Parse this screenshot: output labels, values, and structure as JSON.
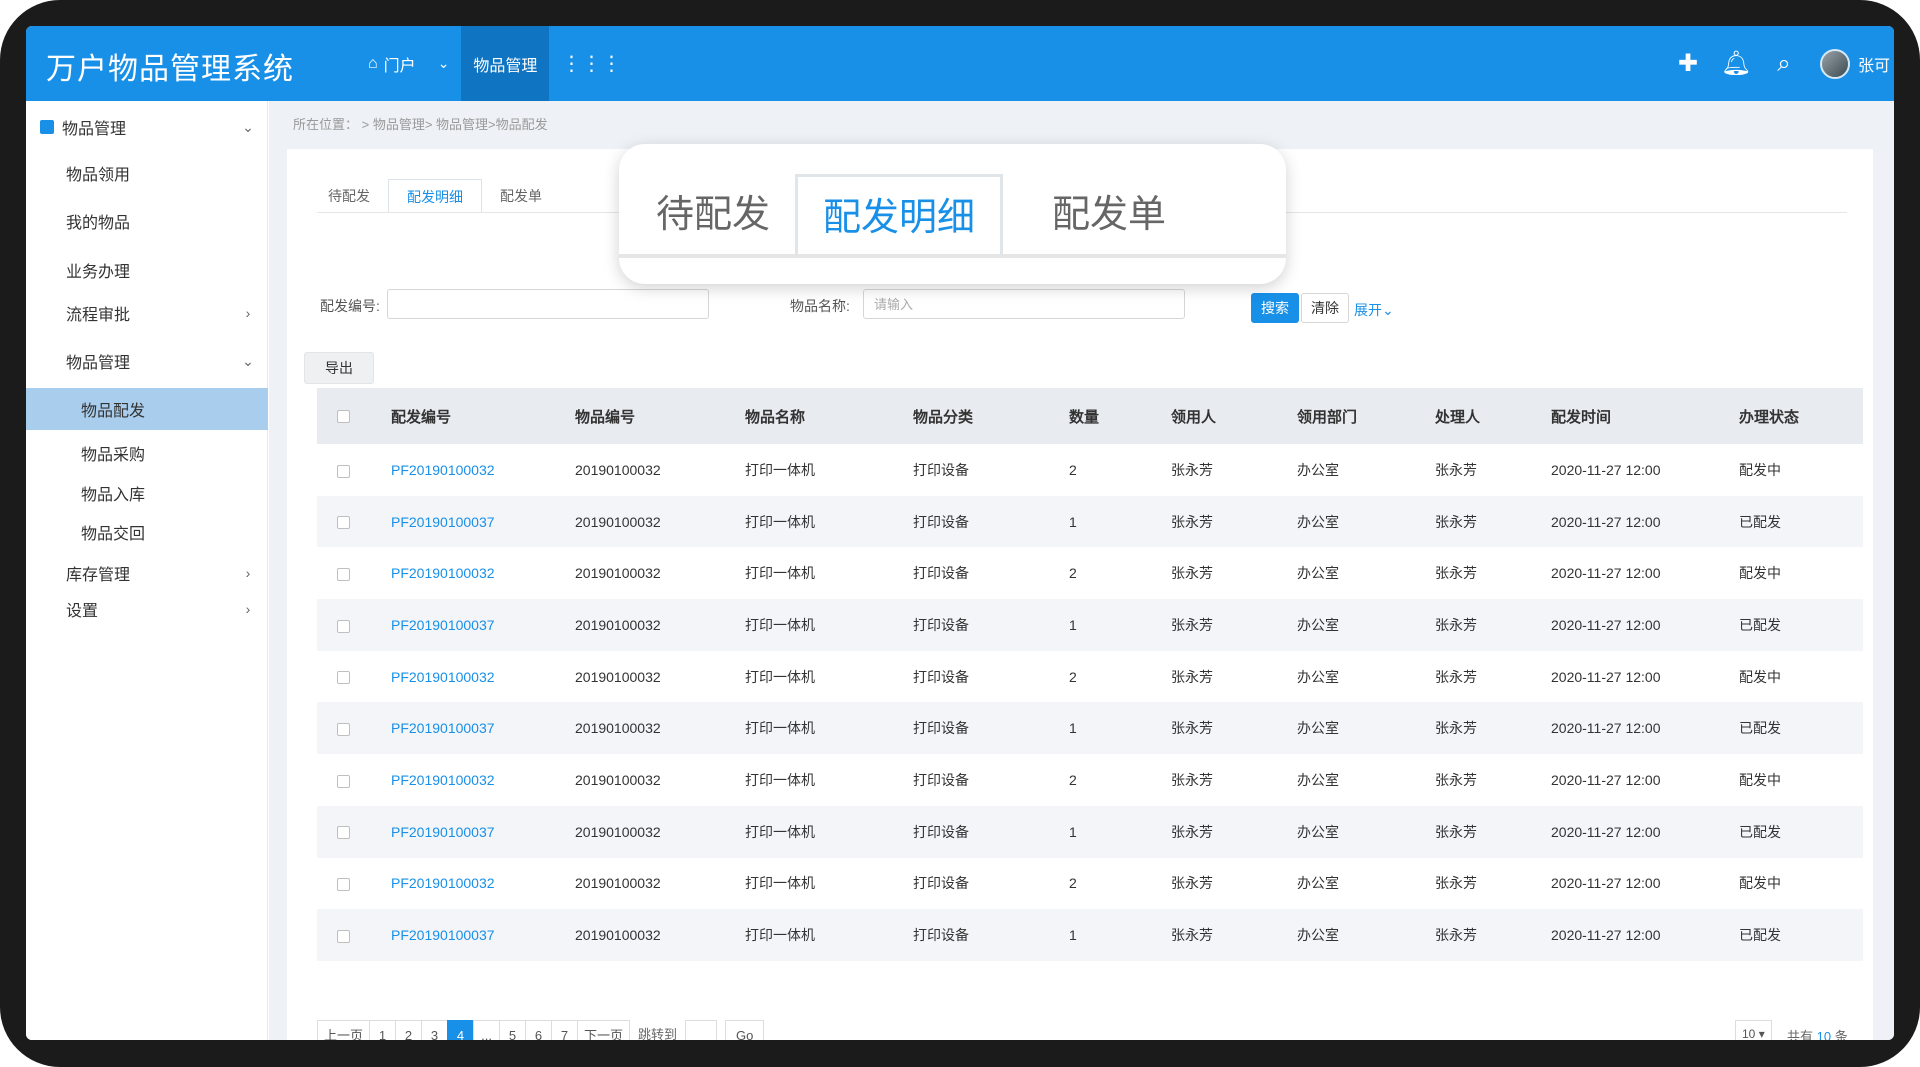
{
  "header": {
    "app_title": "万户物品管理系统",
    "nav": [
      {
        "icon": "home-icon",
        "label": "门户",
        "has_chevron": true
      },
      {
        "label": "物品管理",
        "active": true
      },
      {
        "icon": "grid-icon",
        "label": ""
      }
    ],
    "right_icons": [
      "plus-icon",
      "bell-icon",
      "search-icon"
    ],
    "username": "张可"
  },
  "sidebar": {
    "top": {
      "label": "物品管理"
    },
    "items": [
      {
        "label": "物品领用"
      },
      {
        "label": "我的物品"
      },
      {
        "label": "业务办理"
      },
      {
        "label": "流程审批"
      },
      {
        "label": "物品管理"
      },
      {
        "label": "物品配发",
        "active": true
      },
      {
        "label": "物品采购"
      },
      {
        "label": "物品入库"
      },
      {
        "label": "物品交回"
      },
      {
        "label": "库存管理"
      },
      {
        "label": "设置"
      }
    ]
  },
  "breadcrumb": "所在位置： > 物品管理> 物品管理>物品配发",
  "tabs": [
    "待配发",
    "配发明细",
    "配发单"
  ],
  "active_tab": "配发明细",
  "filters": {
    "code_label": "配发编号:",
    "code_value": "",
    "name_label": "物品名称:",
    "name_placeholder": "请输入",
    "search_label": "搜索",
    "clear_label": "清除",
    "expand_label": "展开"
  },
  "export_label": "导出",
  "table": {
    "columns": [
      "配发编号",
      "物品编号",
      "物品名称",
      "物品分类",
      "数量",
      "领用人",
      "领用部门",
      "处理人",
      "配发时间",
      "办理状态"
    ],
    "rows": [
      [
        "PF20190100032",
        "20190100032",
        "打印一体机",
        "打印设备",
        "2",
        "张永芳",
        "办公室",
        "张永芳",
        "2020-11-27 12:00",
        "配发中"
      ],
      [
        "PF20190100037",
        "20190100032",
        "打印一体机",
        "打印设备",
        "1",
        "张永芳",
        "办公室",
        "张永芳",
        "2020-11-27 12:00",
        "已配发"
      ],
      [
        "PF20190100032",
        "20190100032",
        "打印一体机",
        "打印设备",
        "2",
        "张永芳",
        "办公室",
        "张永芳",
        "2020-11-27 12:00",
        "配发中"
      ],
      [
        "PF20190100037",
        "20190100032",
        "打印一体机",
        "打印设备",
        "1",
        "张永芳",
        "办公室",
        "张永芳",
        "2020-11-27 12:00",
        "已配发"
      ],
      [
        "PF20190100032",
        "20190100032",
        "打印一体机",
        "打印设备",
        "2",
        "张永芳",
        "办公室",
        "张永芳",
        "2020-11-27 12:00",
        "配发中"
      ],
      [
        "PF20190100037",
        "20190100032",
        "打印一体机",
        "打印设备",
        "1",
        "张永芳",
        "办公室",
        "张永芳",
        "2020-11-27 12:00",
        "已配发"
      ],
      [
        "PF20190100032",
        "20190100032",
        "打印一体机",
        "打印设备",
        "2",
        "张永芳",
        "办公室",
        "张永芳",
        "2020-11-27 12:00",
        "配发中"
      ],
      [
        "PF20190100037",
        "20190100032",
        "打印一体机",
        "打印设备",
        "1",
        "张永芳",
        "办公室",
        "张永芳",
        "2020-11-27 12:00",
        "已配发"
      ],
      [
        "PF20190100032",
        "20190100032",
        "打印一体机",
        "打印设备",
        "2",
        "张永芳",
        "办公室",
        "张永芳",
        "2020-11-27 12:00",
        "配发中"
      ],
      [
        "PF20190100037",
        "20190100032",
        "打印一体机",
        "打印设备",
        "1",
        "张永芳",
        "办公室",
        "张永芳",
        "2020-11-27 12:00",
        "已配发"
      ]
    ]
  },
  "pagination": {
    "prev": "上一页",
    "pages": [
      "1",
      "2",
      "3",
      "4",
      "...",
      "5",
      "6",
      "7"
    ],
    "current": "4",
    "next": "下一页",
    "jump_label": "跳转到",
    "go": "Go",
    "page_size": "10",
    "total_prefix": "共有",
    "total": "10",
    "total_suffix": "条"
  },
  "colors": {
    "primary": "#1890e8",
    "active_sidebar": "#a9cdec"
  }
}
